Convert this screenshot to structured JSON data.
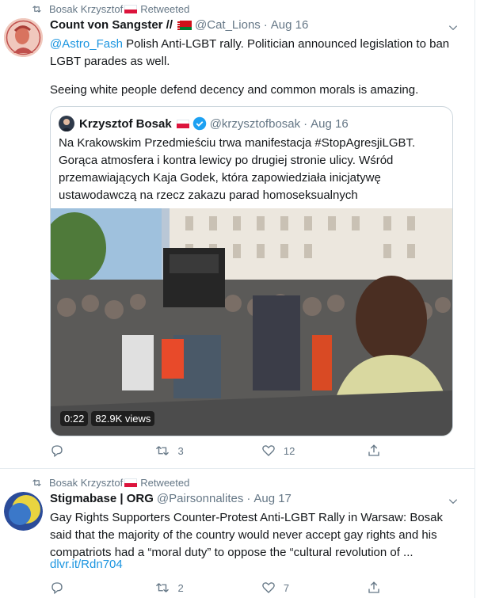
{
  "tweets": [
    {
      "retweeted_by": "Bosak Krzysztof",
      "retweet_label": "Retweeted",
      "author_name": "Count von Sangster //",
      "author_handle": "@Cat_Lions",
      "separator": "·",
      "date": "Aug 16",
      "mention": "@Astro_Fash",
      "text_line1": "Polish Anti-LGBT rally. Politician announced legislation to ban LGBT parades as well.",
      "text_line2": "Seeing white people defend decency and common morals is amazing.",
      "quoted": {
        "author_name": "Krzysztof Bosak",
        "author_handle": "@krzysztofbosak",
        "separator": "·",
        "date": "Aug 16",
        "text": "Na Krakowskim Przedmieściu trwa manifestacja #StopAgresjiLGBT. Gorąca atmosfera i kontra lewicy po drugiej stronie ulicy. Wśród przemawiających Kaja Godek, która zapowiedziała inicjatywę ustawodawczą na rzecz zakazu parad homoseksualnych",
        "video_duration": "0:22",
        "video_views": "82.9K views"
      },
      "reply_count": "",
      "retweet_count": "3",
      "like_count": "12"
    },
    {
      "retweeted_by": "Bosak Krzysztof",
      "retweet_label": "Retweeted",
      "author_name": "Stigmabase | ORG",
      "author_handle": "@Pairsonnalites",
      "separator": "·",
      "date": "Aug 17",
      "text": "Gay Rights Supporters Counter-Protest Anti-LGBT Rally in Warsaw: Bosak said that the majority of the country would never accept gay rights and his compatriots had a “moral duty” to oppose the “cultural revolution of ...",
      "link": "dlvr.it/Rdn704",
      "reply_count": "",
      "retweet_count": "2",
      "like_count": "7"
    }
  ],
  "colors": {
    "link": "#1b95e0",
    "secondary_text": "#657786",
    "border": "#e6ecf0",
    "verified": "#1da1f2"
  },
  "icons": [
    "retweet-icon",
    "caret-down-icon",
    "verified-badge-icon",
    "reply-icon",
    "like-icon",
    "share-icon",
    "poland-flag-icon",
    "belarus-flag-icon"
  ]
}
